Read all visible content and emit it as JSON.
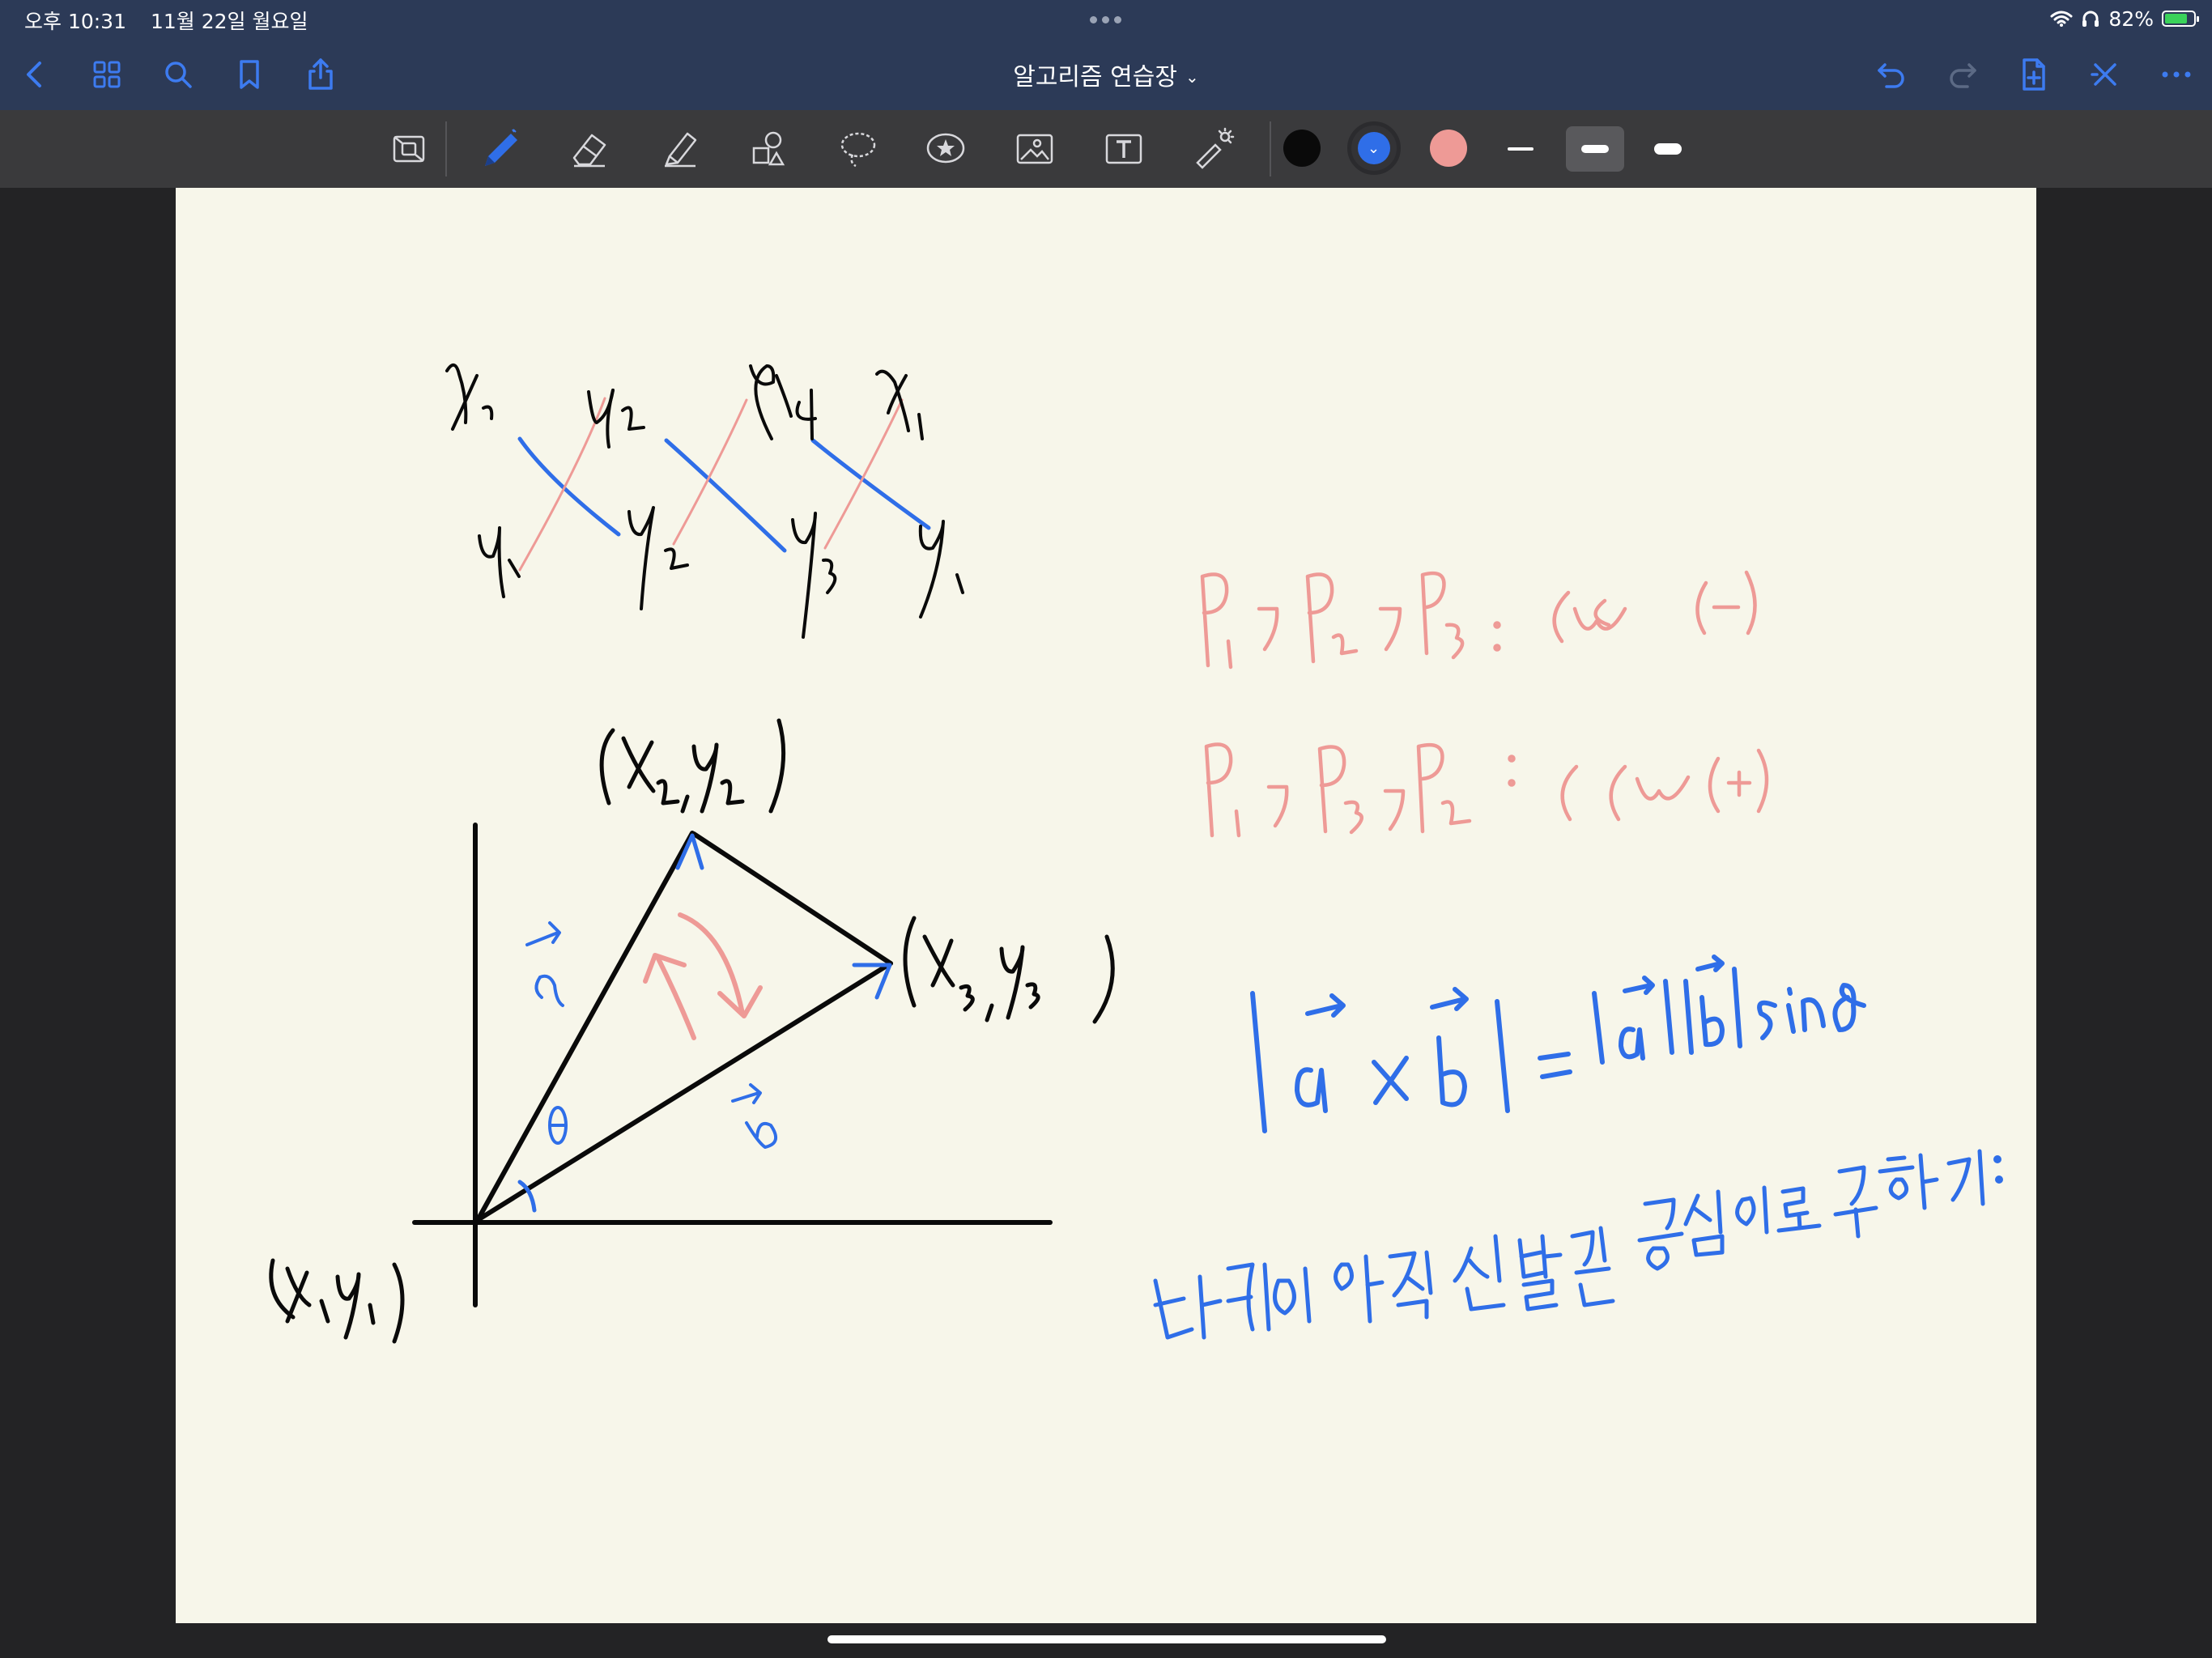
{
  "status_bar": {
    "time": "오후 10:31",
    "date": "11월 22일 월요일",
    "battery_percent": "82%",
    "battery_level": 0.82,
    "battery_color": "#3ad25a"
  },
  "nav_bar": {
    "background": "#2c3a57",
    "title": "알고리즘 연습장",
    "left_icons": [
      "back-chevron-icon",
      "grid-thumbnails-icon",
      "search-icon",
      "bookmark-icon",
      "share-icon"
    ],
    "right_icons": [
      "undo-icon",
      "redo-icon",
      "add-page-icon",
      "close-icon",
      "more-icon"
    ]
  },
  "toolbar": {
    "tools": [
      "zoom-window-icon",
      "pen-icon",
      "eraser-icon",
      "highlighter-icon",
      "shapes-icon",
      "lasso-icon",
      "elements-sticker-icon",
      "image-icon",
      "text-box-icon",
      "laser-pointer-icon"
    ],
    "selected_tool": "pen-icon",
    "colors": [
      "#0a0a0a",
      "#2f6ee8",
      "#ee9a96"
    ],
    "selected_color": "#2f6ee8",
    "stroke_widths": [
      "thin",
      "medium",
      "thick"
    ],
    "selected_stroke": "medium"
  },
  "page": {
    "background": "#f7f6ea",
    "ink_colors": {
      "black": "#0a0a0a",
      "blue": "#2f6ee8",
      "pink": "#ee9a96"
    }
  }
}
